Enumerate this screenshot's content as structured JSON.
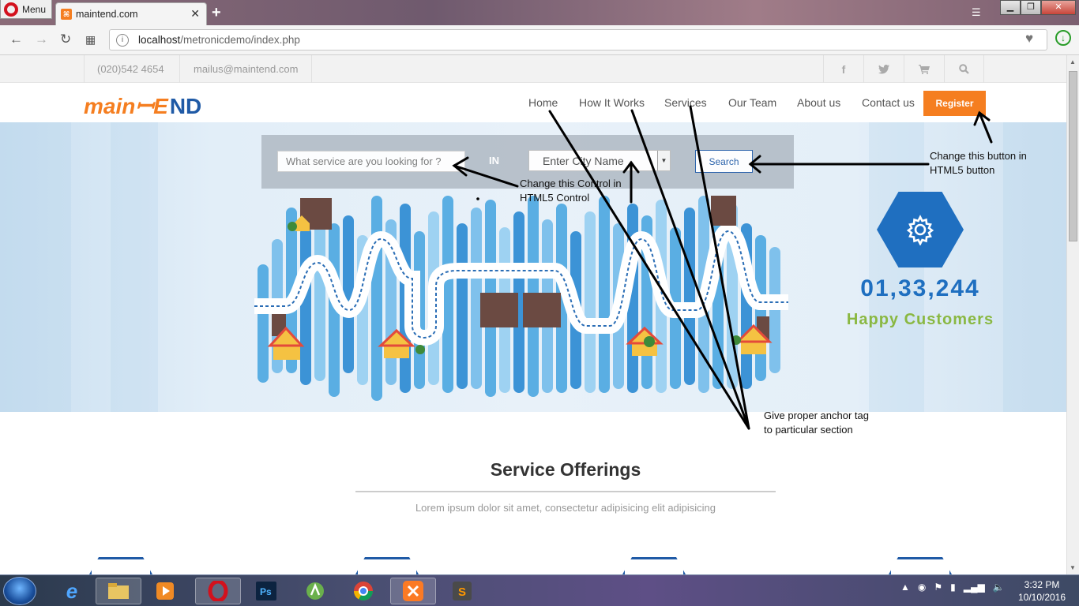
{
  "browser": {
    "menu_label": "Menu",
    "tab_title": "maintend.com",
    "url_host": "localhost",
    "url_path": "/metronicdemo/index.php"
  },
  "topbar": {
    "phone": "(020)542   4654",
    "email": "mailus@maintend.com",
    "social_icons": [
      "facebook-icon",
      "twitter-icon",
      "cart-icon",
      "search-icon"
    ]
  },
  "header": {
    "logo_part1": "mainꟷE",
    "logo_part2": "ND",
    "nav": [
      "Home",
      "How It Works",
      "Services",
      "Our Team",
      "About us",
      "Contact us"
    ],
    "register_label": "Register"
  },
  "search": {
    "service_placeholder": "What service are you looking for ?",
    "in_label": "IN",
    "city_value": "Enter City Name",
    "search_label": "Search"
  },
  "counter": {
    "value": "01,33,244",
    "label": "Happy Customers"
  },
  "offerings": {
    "title": "Service Offerings",
    "subtitle": "Lorem ipsum dolor sit amet, consectetur adipisicing elit adipisicing"
  },
  "annotations": {
    "control_note_line1": "Change this Control in",
    "control_note_line2": "HTML5 Control",
    "button_note_line1": "Change this button in",
    "button_note_line2": "HTML5 button",
    "anchor_note_line1": "Give proper anchor tag",
    "anchor_note_line2": "to particular section"
  },
  "taskbar": {
    "time": "3:32 PM",
    "date": "10/10/2016"
  },
  "colors": {
    "brand_orange": "#f57e20",
    "brand_blue": "#1f5aa6",
    "counter_green": "#8ab842"
  }
}
